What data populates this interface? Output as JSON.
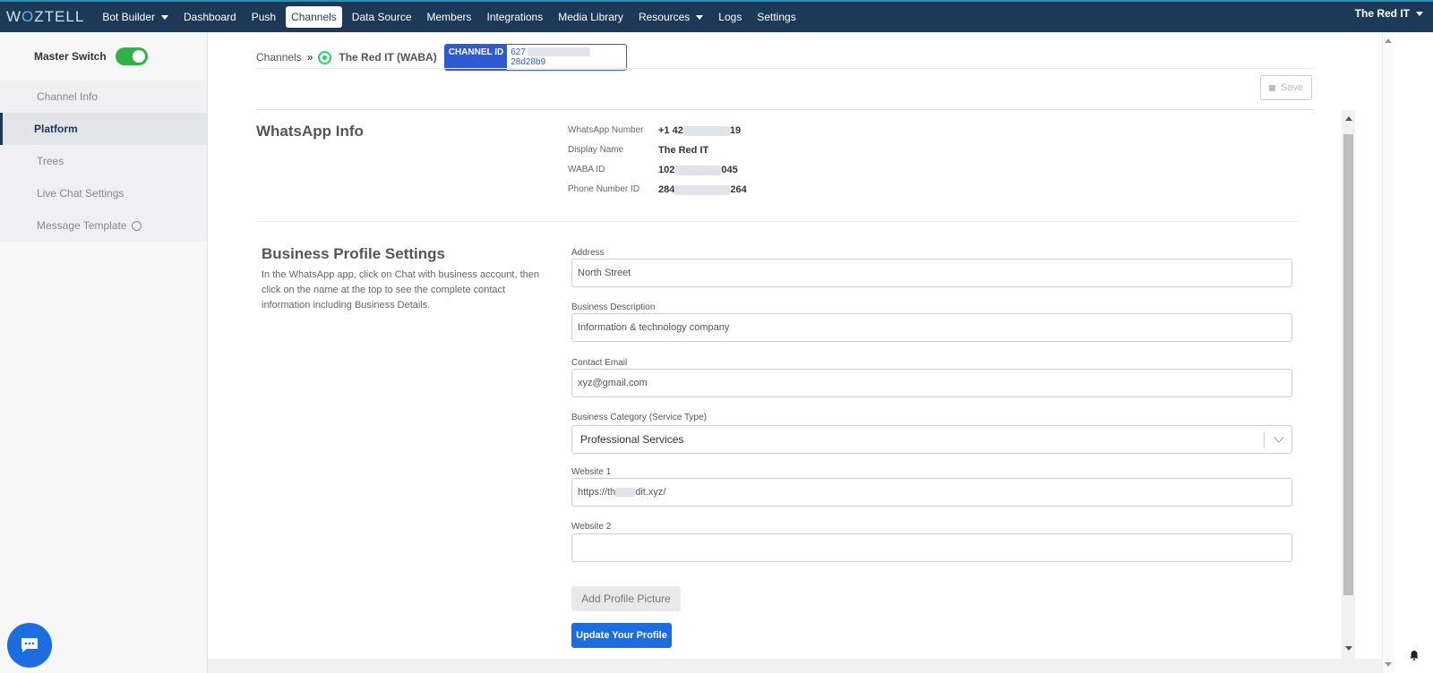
{
  "nav": {
    "logo": "WOZTELL",
    "items": [
      "Bot Builder",
      "Dashboard",
      "Push",
      "Channels",
      "Data Source",
      "Members",
      "Integrations",
      "Media Library",
      "Resources",
      "Logs",
      "Settings"
    ],
    "active": "Channels",
    "user": "The Red IT"
  },
  "sidebar": {
    "master_switch_label": "Master Switch",
    "master_switch_on": true,
    "items": [
      "Channel Info",
      "Platform",
      "Trees",
      "Live Chat Settings",
      "Message Template"
    ],
    "active": "Platform"
  },
  "breadcrumb": {
    "root": "Channels",
    "channel": "The Red IT (WABA)",
    "channel_id_label": "CHANNEL ID",
    "channel_id_prefix": "627",
    "channel_id_suffix": "28d28b9"
  },
  "toolbar": {
    "save_label": "Save"
  },
  "whatsapp_info": {
    "title": "WhatsApp Info",
    "fields": [
      {
        "label": "WhatsApp Number",
        "prefix": "+1 42",
        "suffix": "19"
      },
      {
        "label": "Display Name",
        "prefix": "The Red IT",
        "suffix": ""
      },
      {
        "label": "WABA ID",
        "prefix": "102",
        "suffix": "045"
      },
      {
        "label": "Phone Number ID",
        "prefix": "284",
        "suffix": "264"
      }
    ]
  },
  "business_profile": {
    "title": "Business Profile Settings",
    "description": "In the WhatsApp app, click on Chat with business account, then click on the name at the top to see the complete contact information including Business Details.",
    "address_label": "Address",
    "address_value": "North Street",
    "description_label": "Business Description",
    "description_value": "Information & technology company",
    "email_label": "Contact Email",
    "email_value": "xyz@gmail.com",
    "category_label": "Business Category (Service Type)",
    "category_value": "Professional Services",
    "website1_label": "Website 1",
    "website1_prefix": "https://th",
    "website1_suffix": "dit.xyz/",
    "website2_label": "Website 2",
    "website2_value": "",
    "add_picture_label": "Add Profile Picture",
    "update_label": "Update Your Profile"
  },
  "colors": {
    "nav_bg": "#1c3a57",
    "toggle_on": "#34b04a",
    "primary": "#1b6de0",
    "chip": "#2e5bd4",
    "whatsapp": "#25d366"
  }
}
